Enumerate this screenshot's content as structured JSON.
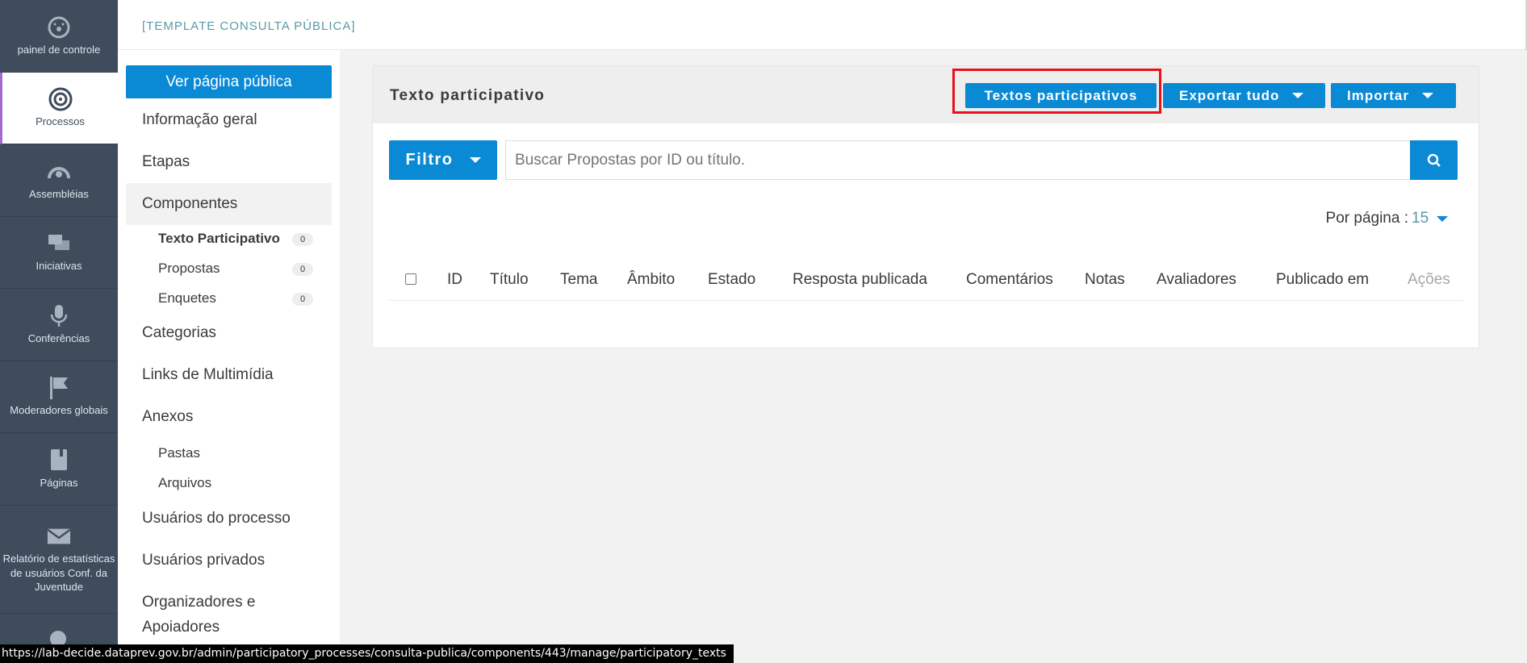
{
  "mainnav": {
    "items": [
      {
        "label": "painel de controle",
        "icon": "dashboard-icon"
      },
      {
        "label": "Processos",
        "icon": "target-icon"
      },
      {
        "label": "Assembléias",
        "icon": "assembly-icon"
      },
      {
        "label": "Iniciativas",
        "icon": "chat-icon"
      },
      {
        "label": "Conferências",
        "icon": "microphone-icon"
      },
      {
        "label": "Moderadores globais",
        "icon": "flag-icon"
      },
      {
        "label": "Páginas",
        "icon": "book-icon"
      },
      {
        "label": "Relatório de estatísticas de usuários Conf. da Juventude",
        "icon": "envelope-icon"
      }
    ]
  },
  "topbar": {
    "title": "[TEMPLATE CONSULTA PÚBLICA]"
  },
  "secnav": {
    "public_button": "Ver página pública",
    "links": {
      "info": "Informação geral",
      "etapas": "Etapas",
      "componentes": "Componentes",
      "categorias": "Categorias",
      "links_multimidia": "Links de Multimídia",
      "anexos": "Anexos",
      "usuarios_processo": "Usuários do processo",
      "usuarios_privados": "Usuários privados",
      "organizadores_1": "Organizadores e",
      "organizadores_2": "Apoiadores"
    },
    "components": [
      {
        "label": "Texto Participativo",
        "count": "0"
      },
      {
        "label": "Propostas",
        "count": "0"
      },
      {
        "label": "Enquetes",
        "count": "0"
      }
    ],
    "anexos_sub": {
      "pastas": "Pastas",
      "arquivos": "Arquivos"
    }
  },
  "card": {
    "title": "Texto participativo",
    "buttons": {
      "textos": "Textos participativos",
      "exportar": "Exportar tudo",
      "importar": "Importar"
    },
    "filter_label": "Filtro",
    "search_placeholder": "Buscar Propostas por ID ou título.",
    "per_page_label": "Por página :",
    "per_page_value": "15",
    "columns": [
      "ID",
      "Título",
      "Tema",
      "Âmbito",
      "Estado",
      "Resposta publicada",
      "Comentários",
      "Notas",
      "Avaliadores",
      "Publicado em",
      "Ações"
    ]
  },
  "statusbar": {
    "url": "https://lab-decide.dataprev.gov.br/admin/participatory_processes/consulta-publica/components/443/manage/participatory_texts"
  },
  "colors": {
    "accent": "#0a89d5",
    "nav_bg": "#3e4c5c",
    "highlight": "#e8101a",
    "active_border": "#a26bd1"
  }
}
